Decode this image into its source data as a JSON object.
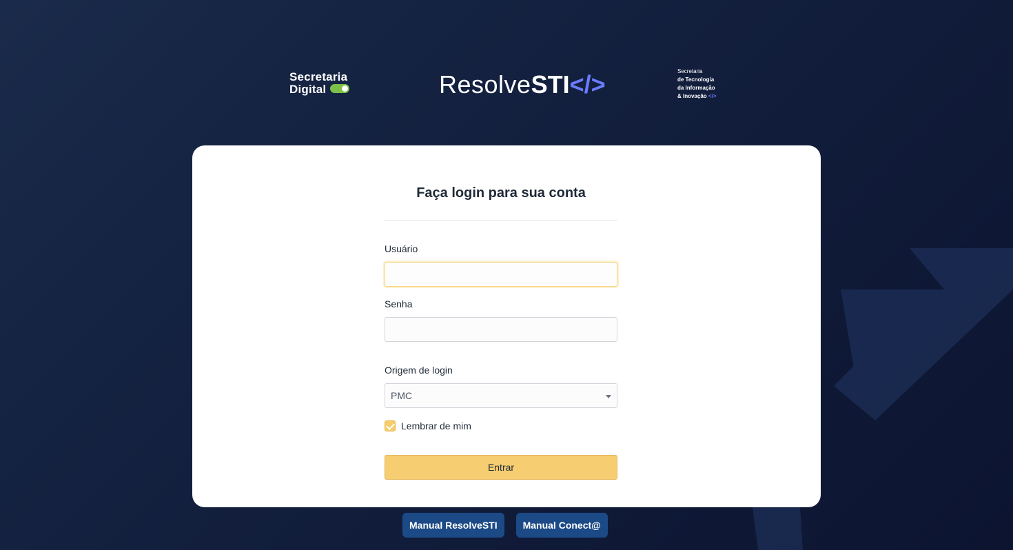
{
  "header": {
    "logo_left": {
      "line1": "Secretaria",
      "line2": "Digital"
    },
    "logo_center": {
      "light": "Resolve",
      "bold": "STI",
      "code": "</>"
    },
    "logo_right": {
      "line1": "Secretaria",
      "line2": "de Tecnologia",
      "line3": "da Informação",
      "line4": "& Inovação",
      "code": "</>"
    }
  },
  "login": {
    "title": "Faça login para sua conta",
    "username_label": "Usuário",
    "username_value": "",
    "password_label": "Senha",
    "password_value": "",
    "origin_label": "Origem de login",
    "origin_selected": "PMC",
    "remember_label": "Lembrar de mim",
    "remember_checked": true,
    "submit_label": "Entrar"
  },
  "manuals": {
    "resolve_label": "Manual ResolveSTI",
    "conecta_label": "Manual Conect@"
  },
  "colors": {
    "accent": "#f6cd70",
    "manual_button": "#1c4a86",
    "background": "#121f3d",
    "code_blue": "#6b7cff"
  }
}
